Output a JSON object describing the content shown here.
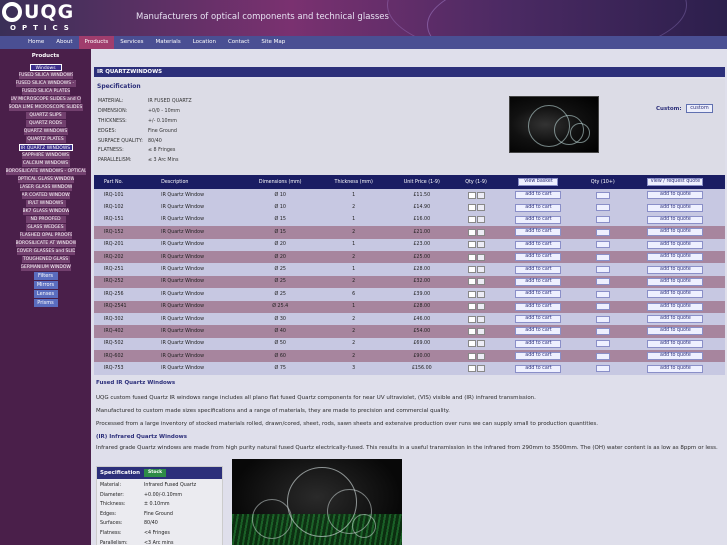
{
  "header": {
    "logo_text": "UQG",
    "logo_sub": "OPTICS",
    "tagline": "Manufacturers of optical components and technical glasses"
  },
  "nav": [
    "Home",
    "About",
    "Products",
    "Services",
    "Materials",
    "Location",
    "Contact",
    "Site Map"
  ],
  "nav_active": "Products",
  "sidebar": {
    "heading": "Products",
    "items": [
      {
        "label": "Windows",
        "type": "hl",
        "w": 32
      },
      {
        "label": "FUSED SILICA WINDOWS",
        "type": "item",
        "w": 54
      },
      {
        "label": "FUSED SILICA WINDOWS - WE",
        "type": "item",
        "w": 60
      },
      {
        "label": "FUSED SILICA PLATES",
        "type": "item",
        "w": 48
      },
      {
        "label": "UV MICROSCOPE SLIDES and COVER SLIPS",
        "type": "item",
        "w": 70
      },
      {
        "label": "SODA LIME MICROSCOPE SLIDES and",
        "type": "item",
        "w": 74
      },
      {
        "label": "QUARTZ SLIPS",
        "type": "item",
        "w": 40
      },
      {
        "label": "QUARTZ RODS",
        "type": "item",
        "w": 40
      },
      {
        "label": "QUARTZ WINDOWS",
        "type": "item",
        "w": 44
      },
      {
        "label": "QUARTZ PLATES",
        "type": "item",
        "w": 40
      },
      {
        "label": "IR QUARTZ WINDOWS",
        "type": "hl",
        "w": 54
      },
      {
        "label": "SAPPHIRE WINDOWS",
        "type": "item",
        "w": 48
      },
      {
        "label": "CALCIUM WINDOWS",
        "type": "item",
        "w": 48
      },
      {
        "label": "BOROSILICATE WINDOWS - OPTICAL",
        "type": "item",
        "w": 80
      },
      {
        "label": "OPTICAL GLASS WINDOWS",
        "type": "item",
        "w": 56
      },
      {
        "label": "LASER GLASS WINDOWS",
        "type": "item",
        "w": 52
      },
      {
        "label": "AR COATED WINDOWS",
        "type": "item",
        "w": 48
      },
      {
        "label": "IR/LT WINDOWS",
        "type": "item",
        "w": 40
      },
      {
        "label": "BK7 GLASS WINDOWS",
        "type": "item",
        "w": 46
      },
      {
        "label": "ND PROOFED",
        "type": "item",
        "w": 40
      },
      {
        "label": "GLASS WEDGES",
        "type": "item",
        "w": 40
      },
      {
        "label": "FLASHED OPAL PROOFED",
        "type": "item",
        "w": 52
      },
      {
        "label": "BOROSILICATE AT WINDOWS",
        "type": "item",
        "w": 60
      },
      {
        "label": "COVER GLASSES and SLIDES",
        "type": "item",
        "w": 58
      },
      {
        "label": "TOUGHENED GLASS",
        "type": "item",
        "w": 48
      },
      {
        "label": "GERMANIUM WINDOWS",
        "type": "item",
        "w": 50
      },
      {
        "label": "Filters",
        "type": "sub",
        "w": 24
      },
      {
        "label": "Mirrors",
        "type": "sub",
        "w": 24
      },
      {
        "label": "Lenses",
        "type": "sub",
        "w": 24
      },
      {
        "label": "Prisms",
        "type": "sub",
        "w": 24
      }
    ]
  },
  "page": {
    "title": "IR QUARTZWINDOWS"
  },
  "spec": {
    "heading": "Specification",
    "rows": [
      {
        "k": "MATERIAL:",
        "v": "IR FUSED QUARTZ"
      },
      {
        "k": "DIMENSION:",
        "v": "+0/0 - 10mm"
      },
      {
        "k": "THICKNESS:",
        "v": "+/- 0.10mm"
      },
      {
        "k": "EDGES:",
        "v": "Fine Ground"
      },
      {
        "k": "SURFACE QUALITY:",
        "v": "80/40"
      },
      {
        "k": "FLATNESS:",
        "v": "≤ 8 Fringes"
      },
      {
        "k": "PARALLELISM:",
        "v": "≤ 3 Arc Mins"
      }
    ],
    "custom_label": "Custom:",
    "custom_button": "custom"
  },
  "table": {
    "headers": [
      "Part No.",
      "Description",
      "Dimensions (mm)",
      "Thickness (mm)",
      "Unit Price (1-9)",
      "Qty (1-9)",
      "",
      "Qty (10+)",
      ""
    ],
    "view_basket": "view basket",
    "view_quote": "view / request quote",
    "add_cart": "add to cart",
    "add_quote": "add to quote",
    "rows": [
      {
        "part": "IRQ-101",
        "desc": "IR Quartz Window",
        "dim": "Ø 10",
        "thk": "1",
        "price": "£11.50",
        "shade": "r-light"
      },
      {
        "part": "IRQ-102",
        "desc": "IR Quartz Window",
        "dim": "Ø 10",
        "thk": "2",
        "price": "£14.90",
        "shade": "r-light"
      },
      {
        "part": "IRQ-151",
        "desc": "IR Quartz Window",
        "dim": "Ø 15",
        "thk": "1",
        "price": "£16.00",
        "shade": "r-light"
      },
      {
        "part": "IRQ-152",
        "desc": "IR Quartz Window",
        "dim": "Ø 15",
        "thk": "2",
        "price": "£21.00",
        "shade": "r-dark"
      },
      {
        "part": "IRQ-201",
        "desc": "IR Quartz Window",
        "dim": "Ø 20",
        "thk": "1",
        "price": "£23.00",
        "shade": "r-light"
      },
      {
        "part": "IRQ-202",
        "desc": "IR Quartz Window",
        "dim": "Ø 20",
        "thk": "2",
        "price": "£25.00",
        "shade": "r-dark"
      },
      {
        "part": "IRQ-251",
        "desc": "IR Quartz Window",
        "dim": "Ø 25",
        "thk": "1",
        "price": "£28.00",
        "shade": "r-light"
      },
      {
        "part": "IRQ-252",
        "desc": "IR Quartz Window",
        "dim": "Ø 25",
        "thk": "2",
        "price": "£32.00",
        "shade": "r-dark"
      },
      {
        "part": "IRQ-256",
        "desc": "IR Quartz Window",
        "dim": "Ø 25",
        "thk": "6",
        "price": "£39.00",
        "shade": "r-light"
      },
      {
        "part": "IRQ-2541",
        "desc": "IR Quartz Window",
        "dim": "Ø 25.4",
        "thk": "1",
        "price": "£28.00",
        "shade": "r-dark"
      },
      {
        "part": "IRQ-302",
        "desc": "IR Quartz Window",
        "dim": "Ø 30",
        "thk": "2",
        "price": "£46.00",
        "shade": "r-light"
      },
      {
        "part": "IRQ-402",
        "desc": "IR Quartz Window",
        "dim": "Ø 40",
        "thk": "2",
        "price": "£54.00",
        "shade": "r-dark"
      },
      {
        "part": "IRQ-502",
        "desc": "IR Quartz Window",
        "dim": "Ø 50",
        "thk": "2",
        "price": "£69.00",
        "shade": "r-light"
      },
      {
        "part": "IRQ-602",
        "desc": "IR Quartz Window",
        "dim": "Ø 60",
        "thk": "2",
        "price": "£90.00",
        "shade": "r-dark"
      },
      {
        "part": "IRQ-753",
        "desc": "IR Quartz Window",
        "dim": "Ø 75",
        "thk": "3",
        "price": "£156.00",
        "shade": "r-light"
      }
    ],
    "qty_default": "1"
  },
  "description": {
    "heading": "Fused IR Quartz Windows",
    "p1": "UQG custom fused Quartz IR windows range includes all plano flat fused Quartz components for near UV ultraviolet, (VIS) visible and (IR) infrared transmission.",
    "p2": "Manufactured to custom made sizes specifications and a range of materials, they are made to precision and commercial quality.",
    "p3": "Processed from a large inventory of stocked materials rolled, drawn/cored, sheet, rods, sawn sheets and extensive production over runs we can supply small to production quantities.",
    "heading2": "(IR) Infrared Quartz Windows",
    "p4": "Infrared grade Quartz windows are made from high purity natural fused Quartz electrically-fused. This results in a useful transmission in the infrared from 290mm to 3500mm. The (OH) water content is as low as 8ppm or less."
  },
  "spec2": {
    "heading": "Specification",
    "badge": "Stock",
    "rows": [
      {
        "k": "Material:",
        "v": "Infrared Fused Quartz"
      },
      {
        "k": "Diameter:",
        "v": "+0.00/-0.10mm"
      },
      {
        "k": "Thickness:",
        "v": "± 0.10mm"
      },
      {
        "k": "Edges:",
        "v": "Fine Ground"
      },
      {
        "k": "Surfaces:",
        "v": "80/40"
      },
      {
        "k": "Flatness:",
        "v": "<4 Fringes"
      },
      {
        "k": "Parallelism:",
        "v": "<3 Arc mins"
      }
    ]
  }
}
